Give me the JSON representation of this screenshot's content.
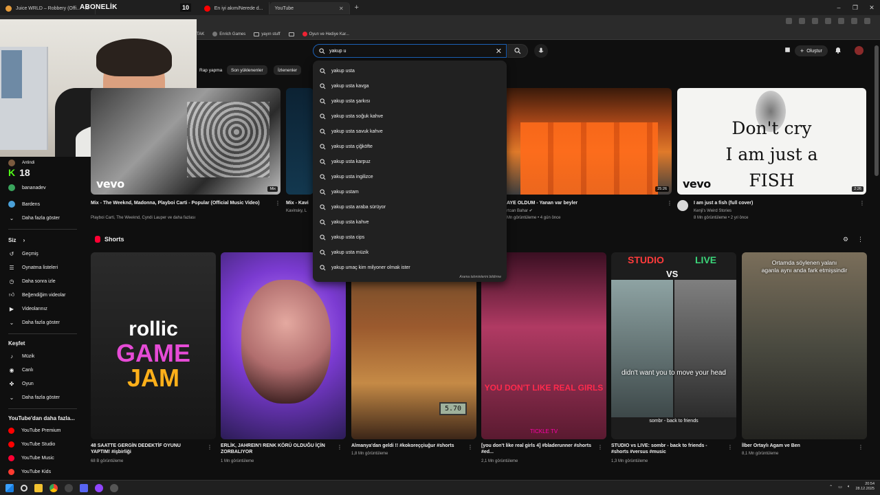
{
  "browser": {
    "tabs": [
      {
        "label": "Juice WRLD – Robbery (Offi...",
        "icon_color": "#e59b3b"
      },
      {
        "label": "En iyi akım/Nerede d...",
        "icon_color": "#ff0000"
      },
      {
        "label": "YouTube",
        "icon_color": "#ff0000"
      }
    ],
    "new_tab": "+",
    "subscribe_overlay": "ABONELİK",
    "subscribe_count": "10",
    "bookmarks": [
      "TAK",
      "Enrich Games",
      "yayın stuff",
      "",
      "Oyun ve Hediye Kar..."
    ],
    "window_controls": [
      "–",
      "❐",
      "✕"
    ]
  },
  "search": {
    "query": "yakup u",
    "suggestions": [
      "yakup usta",
      "yakup usta kavga",
      "yakup usta şarkısı",
      "yakup usta soğuk kahve",
      "yakup usta savuk kahve",
      "yakup usta çiğköfte",
      "yakup usta karpuz",
      "yakup usta ingilizce",
      "yakup ustam",
      "yakup usta araba sürüyor",
      "yakup usta kahve",
      "yakup usta cips",
      "yakup usta müzik",
      "yakup umaç kim milyoner olmak ister"
    ],
    "report": "Arama tahminlerini bildirme"
  },
  "header": {
    "create_label": "Oluştur"
  },
  "chips": [
    "Rap yapma",
    "Son yüklenenler",
    "İzlenenler"
  ],
  "guide": {
    "subscriptions": [
      {
        "label": "Antindi",
        "color": "#7b5a3f"
      },
      {
        "label": "18",
        "color": "#53fc18"
      },
      {
        "label": "bananadev",
        "color": "#3aa55d"
      },
      {
        "label": "Bardens",
        "color": "#4aa0d8"
      }
    ],
    "more1": "Daha fazla göster",
    "you_label": "Siz",
    "you_items": [
      "Geçmiş",
      "Oynatma listeleri",
      "Daha sonra izle",
      "Beğendiğim videolar",
      "Videolarınız",
      "Daha fazla göster"
    ],
    "explore_label": "Keşfet",
    "explore_items": [
      "Müzik",
      "Canlı",
      "Oyun",
      "Daha fazla göster"
    ],
    "more_from_label": "YouTube'dan daha fazla...",
    "more_from_items": [
      "YouTube Premium",
      "YouTube Studio",
      "YouTube Music",
      "YouTube Kids"
    ]
  },
  "videos": [
    {
      "title": "Mix - The Weeknd, Madonna, Playboi Carti - Popular (Official Music Video)",
      "meta": "Playboi Carti, The Weeknd, Cyndi Lauper ve daha fazlası",
      "badge": "Mix",
      "brand": "vevo"
    },
    {
      "title": "Mix - Kavi",
      "meta": "Kavinsky, L",
      "badge": "",
      "brand": ""
    },
    {
      "title": "AYE OLDUM - Yanan var beyler",
      "meta": "Mn görüntüleme • 4 gün önce",
      "channel": "rtcan Bahar ✔",
      "badge": "25:26",
      "brand": ""
    },
    {
      "title": "I am just a fish (full cover)",
      "meta": "8 Mn görüntüleme • 2 yıl önce",
      "channel": "Kenji's Weird Stories",
      "badge": "2:26",
      "brand": "vevo",
      "thumb_text": [
        "Don't cry",
        "I am just a",
        "FISH"
      ]
    }
  ],
  "shorts": {
    "heading": "Shorts",
    "items": [
      {
        "title": "48 SAATTE GERGİN DEDEKTİF OYUNU YAPTIM! #işbirliği",
        "meta": "68 B görüntüleme",
        "overlay": [
          "rollic",
          "GAME",
          "JAM"
        ]
      },
      {
        "title": "ERLİK, JAHREIN'I RENK KÖRÜ OLDUĞU İÇİN ZORBALIYOR",
        "meta": "1 Mn görüntüleme",
        "overlay": []
      },
      {
        "title": "Almanya'dan geldi !! #kokoreççiuğur #shorts",
        "meta": "1,8 Mn görüntüleme",
        "overlay": [
          "5.70"
        ]
      },
      {
        "title": "[you don't like real girls 4] #bladerunner #shorts #ed...",
        "meta": "2,1 Mn görüntüleme",
        "overlay": [
          "YOU DON'T LIKE REAL GIRLS",
          "TICKLE TV"
        ]
      },
      {
        "title": "STUDIO vs LIVE: sombr - back to friends - #shorts #versus #music",
        "meta": "1,3 Mn görüntüleme",
        "overlay": [
          "STUDIO",
          "VS",
          "LIVE",
          "didn't want you to move your head",
          "sombr - back to friends"
        ]
      },
      {
        "title": "İlber Ortaylı Agam ve Ben",
        "meta": "8,1 Mn görüntüleme",
        "overlay": [
          "Ortamda söylenen yalanı",
          "aganla aynı anda fark etmişsindir"
        ]
      }
    ]
  },
  "taskbar": {
    "time": "20:54",
    "date": "28.12.2025"
  }
}
